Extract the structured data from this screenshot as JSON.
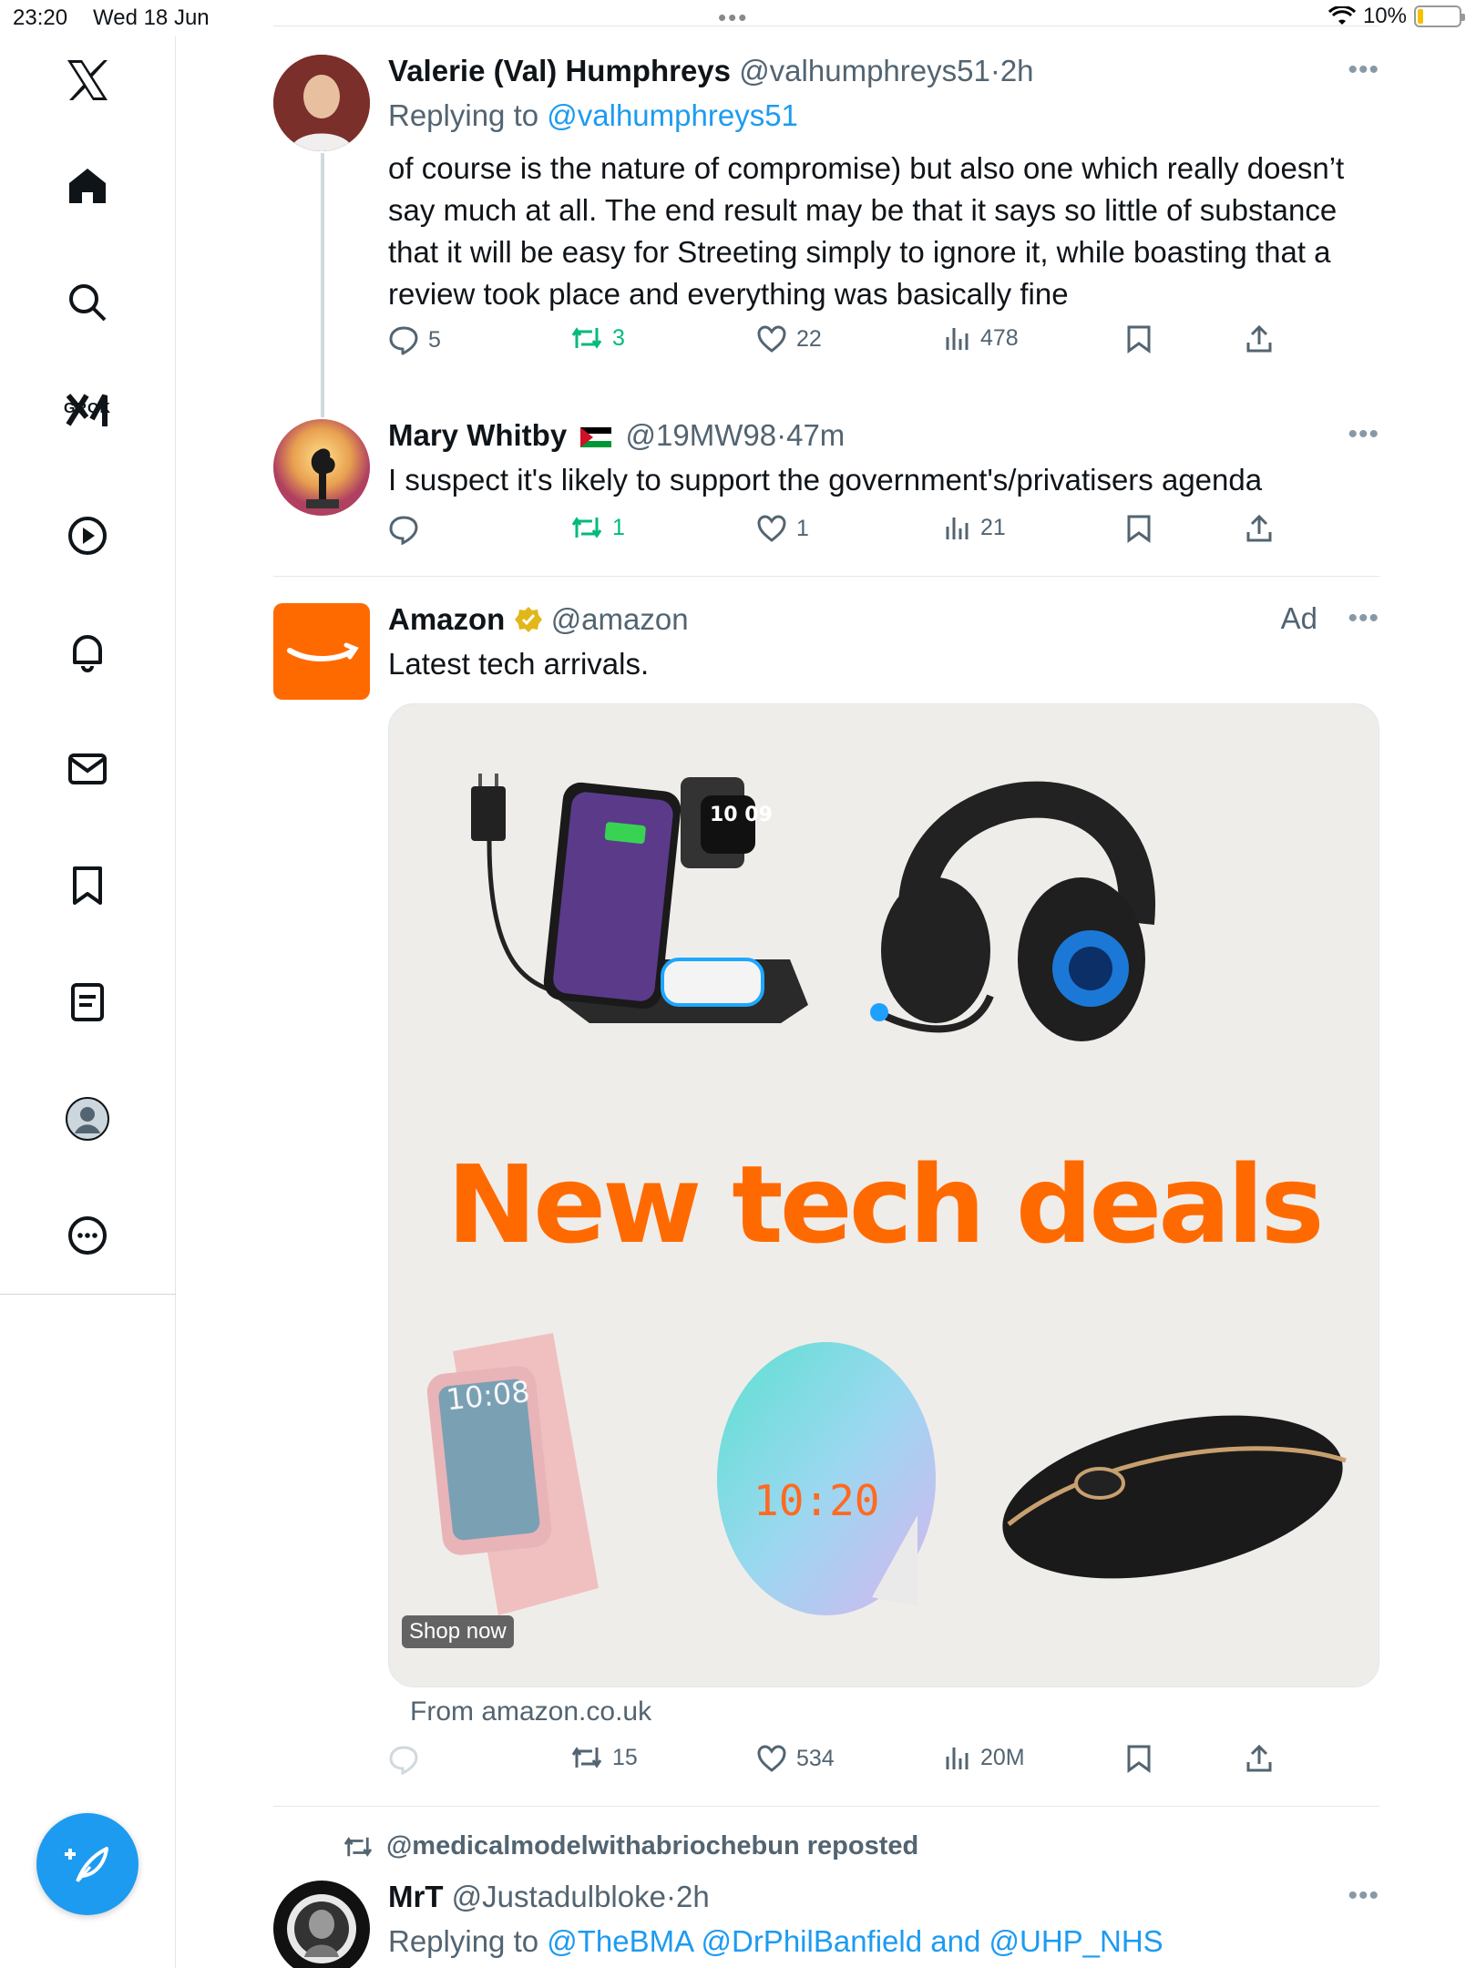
{
  "status_bar": {
    "time": "23:20",
    "date": "Wed 18 Jun",
    "battery": "10%",
    "battery_level": 0.1
  },
  "sidebar": {
    "items": [
      {
        "icon": "x-logo-icon"
      },
      {
        "icon": "home-icon"
      },
      {
        "icon": "search-icon"
      },
      {
        "icon": "grok-icon",
        "label": "GROK"
      },
      {
        "icon": "play-icon"
      },
      {
        "icon": "bell-icon"
      },
      {
        "icon": "mail-icon"
      },
      {
        "icon": "bookmark-icon"
      },
      {
        "icon": "list-icon"
      },
      {
        "icon": "profile-icon"
      },
      {
        "icon": "more-circle-icon"
      }
    ],
    "compose_icon": "compose-feather-icon"
  },
  "tweets": [
    {
      "name": "Valerie (Val) Humphreys",
      "handle": "@valhumphreys51",
      "time": "2h",
      "replying_prefix": "Replying to ",
      "replying_to": "@valhumphreys51",
      "text": "of course is the nature of compromise) but also one which really doesn’t say much at all. The end result may be that it says so little of substance that it will be easy for Streeting simply to ignore it, while boasting that a review took place and everything was basically fine",
      "replies": "5",
      "reposts": "3",
      "likes": "22",
      "views": "478"
    },
    {
      "name": "Mary Whitby",
      "handle": "@19MW98",
      "time": "47m",
      "text": "I suspect it's likely to support the government's/privatisers agenda",
      "replies": "",
      "reposts": "1",
      "likes": "1",
      "views": "21"
    },
    {
      "name": "Amazon",
      "handle": "@amazon",
      "ad_label": "Ad",
      "text": "Latest tech arrivals.",
      "image_headline": "New tech deals",
      "shop_now": "Shop now",
      "from": "From amazon.co.uk",
      "replies": "",
      "reposts": "15",
      "likes": "534",
      "views": "20M",
      "clock_display": "10:20",
      "watch_display": "10:08",
      "smartwatch_display": "10 09"
    },
    {
      "reposted_by": "@medicalmodelwithabriochebun reposted",
      "name": "MrT",
      "handle": "@Justadulbloke",
      "time": "2h",
      "replying_prefix": "Replying to ",
      "replying_to": "@TheBMA @DrPhilBanfield and @UHP_NHS"
    }
  ],
  "colors": {
    "accent": "#1d9bf0",
    "repost": "#00ba7c",
    "amazon_orange": "#ff6a00"
  }
}
